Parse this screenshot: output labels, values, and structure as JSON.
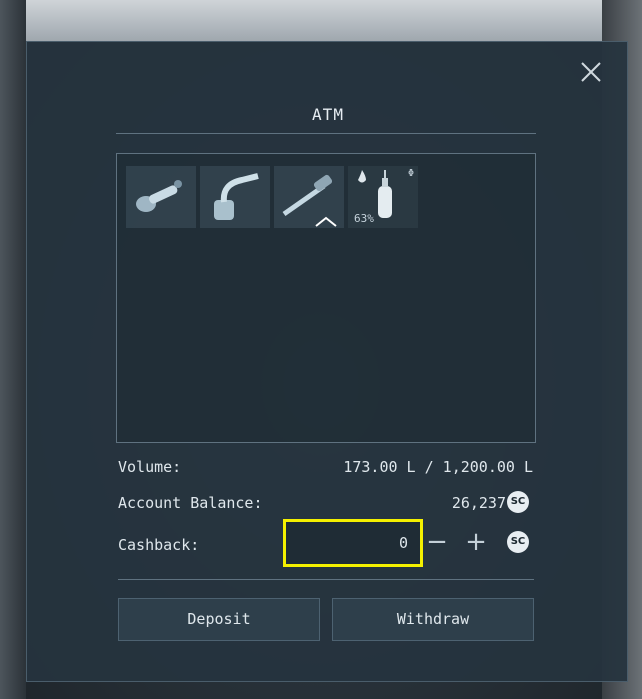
{
  "window": {
    "title": "ATM"
  },
  "inventory": {
    "items": [
      {
        "icon": "angle-grinder-icon"
      },
      {
        "icon": "welder-icon"
      },
      {
        "icon": "hand-drill-icon",
        "indicator": "^"
      },
      {
        "icon": "hydrogen-bottle-icon",
        "fill_label": "63%",
        "corner_mark": "Φ"
      }
    ]
  },
  "stats": {
    "volume_label": "Volume:",
    "volume_value": "173.00 L / 1,200.00 L",
    "balance_label": "Account Balance:",
    "balance_value": "26,237",
    "cashback_label": "Cashback:",
    "cashback_value": "0",
    "currency_badge": "SC"
  },
  "controls": {
    "minus": "−",
    "plus": "+"
  },
  "buttons": {
    "deposit": "Deposit",
    "withdraw": "Withdraw"
  },
  "colors": {
    "highlight": "#f4f000",
    "panel": "#26343e"
  }
}
